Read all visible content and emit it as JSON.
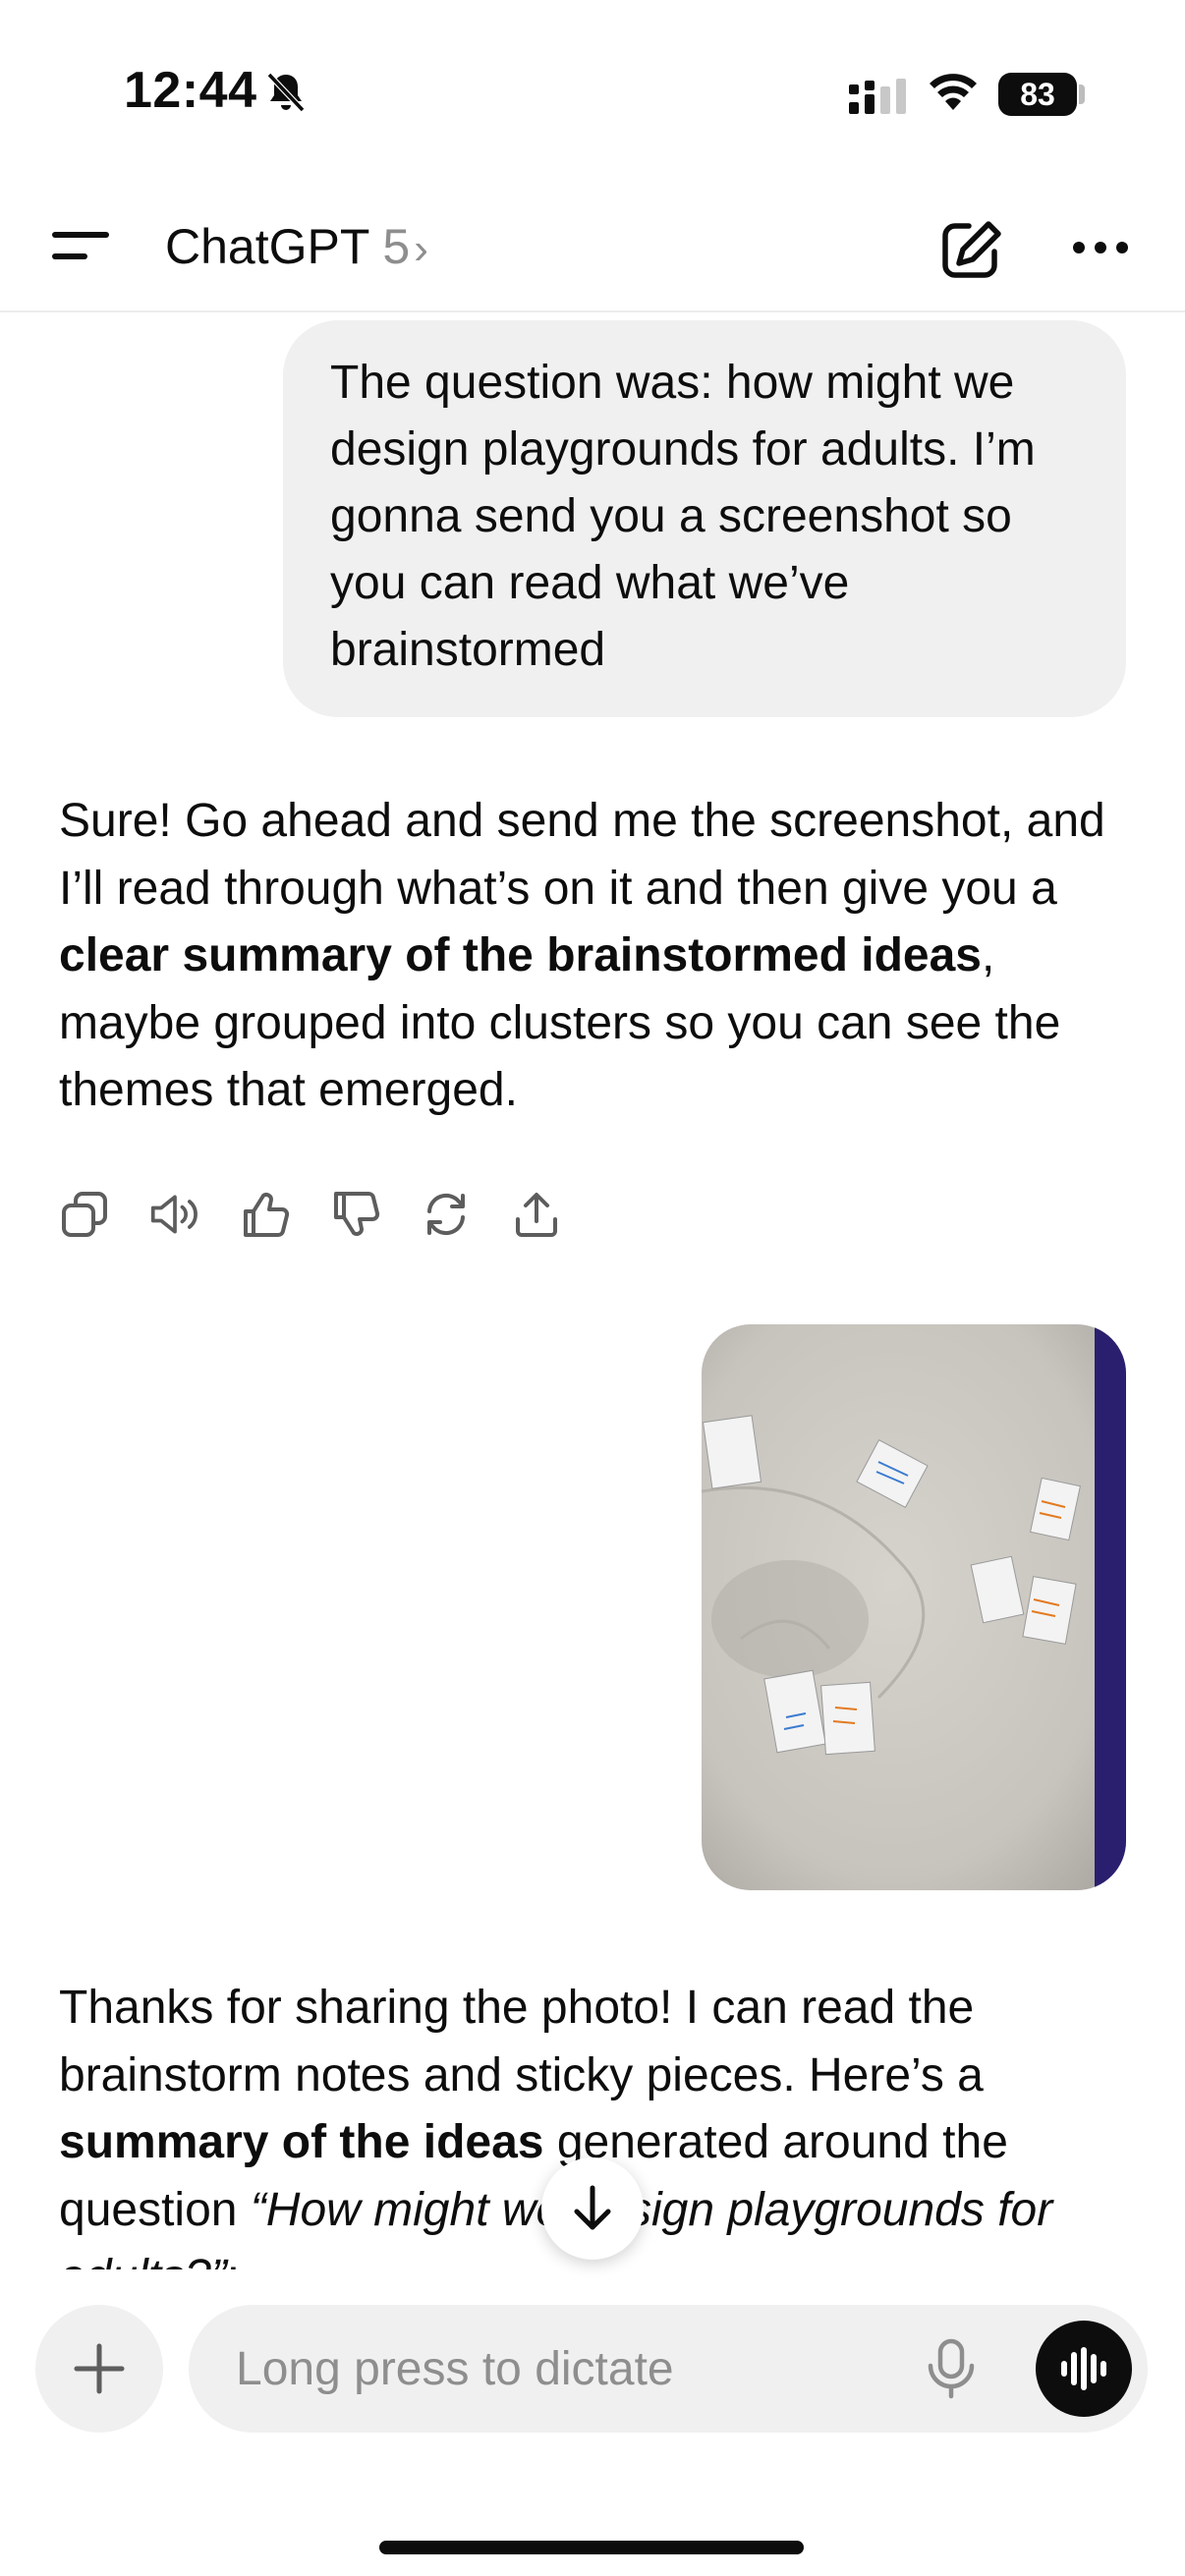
{
  "status_bar": {
    "time": "12:44",
    "battery": "83",
    "icons": [
      "bell-slash-icon",
      "cellular-signal-icon",
      "wifi-icon",
      "battery-icon"
    ]
  },
  "header": {
    "title": "ChatGPT",
    "model": "5",
    "chevron": "›",
    "icons": [
      "menu-icon",
      "new-chat-icon",
      "more-icon"
    ]
  },
  "messages": {
    "user_1": "The question was: how might we design playgrounds for adults. I’m gonna send you a screenshot so you can read what we’ve brainstormed",
    "assistant_1": {
      "part1": "Sure! Go ahead and send me the screenshot, and I’ll read through what’s on it and then give you a ",
      "bold": "clear summary of the brainstormed ideas",
      "part2": ", maybe grouped into clusters so you can see the themes that emerged."
    },
    "action_icons": [
      "copy-icon",
      "read-aloud-icon",
      "thumbs-up-icon",
      "thumbs-down-icon",
      "regenerate-icon",
      "share-icon"
    ],
    "assistant_2": {
      "part1": "Thanks for sharing the photo! I can read the brainstorm notes and sticky pieces. Here’s a ",
      "bold": "summary of the ideas",
      "part2": " generated around the question ",
      "italic": "“How might we design playgrounds for adults?”",
      "part3": ":"
    }
  },
  "composer": {
    "placeholder": "Long press to dictate",
    "icons": [
      "plus-icon",
      "microphone-icon",
      "voice-mode-icon"
    ]
  },
  "colors": {
    "bubble": "#f0f0f0",
    "text": "#0d0d0d",
    "muted": "#8e8e8e",
    "photo_paper": "#cdc9c4",
    "photo_border": "#2a1f6e"
  }
}
